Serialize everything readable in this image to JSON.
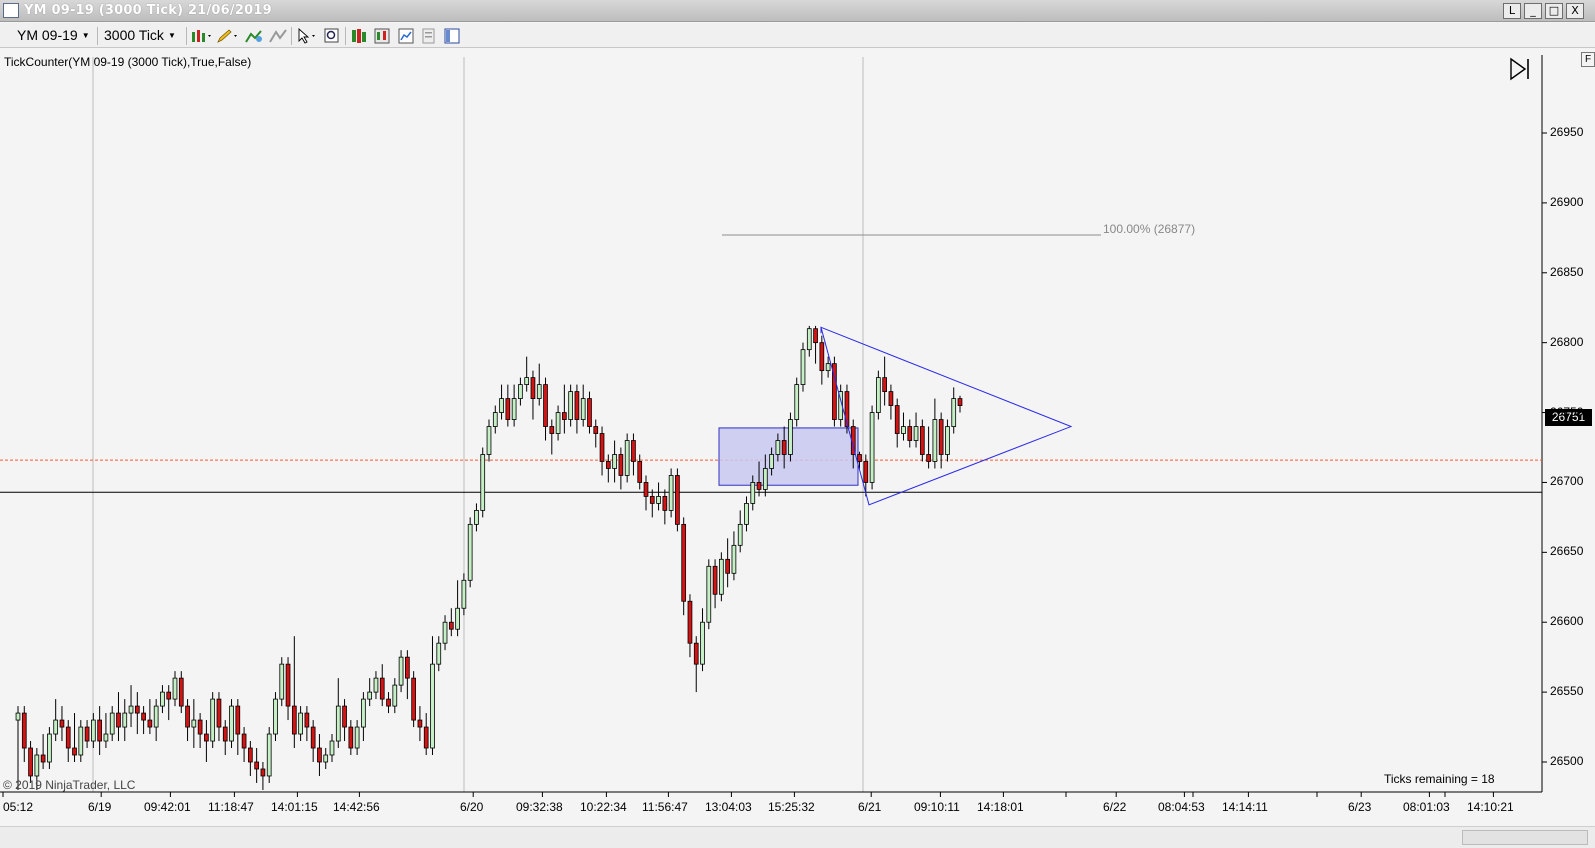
{
  "window": {
    "title": "YM 09-19 (3000 Tick)  21/06/2019",
    "buttons": {
      "restore_small": "L",
      "minimize": "_",
      "maximize": "□",
      "close": "X"
    }
  },
  "toolbar": {
    "instrument": "YM 09-19",
    "interval": "3000 Tick",
    "icons": [
      "bar-type-icon",
      "drawing-pencil-icon",
      "add-indicator-icon",
      "strategy-icon",
      "cursor-icon",
      "zoom-icon",
      "data-box-icon",
      "chart-trader-icon",
      "chart-properties-icon",
      "template-icon",
      "panel-icon"
    ]
  },
  "chart": {
    "indicator_label": "TickCounter(YM 09-19 (3000 Tick),True,False)",
    "ticks_remaining": "Ticks remaining = 18",
    "copyright": "© 2019 NinjaTrader, LLC",
    "fib_label": "100.00% (26877)",
    "current_price": "26751",
    "colors": {
      "up_candle": "#c5f0c5",
      "down_candle": "#d31414",
      "wick": "#000000",
      "triangle": "#2a2ae8",
      "rectangle_fill": "#c8c8f0",
      "rectangle_border": "#3030c0",
      "dashed_line": "#ff5a2a",
      "support_line": "#000000",
      "fib_line": "#8c8c8c"
    }
  },
  "chart_data": {
    "type": "candlestick",
    "price_axis_labels": [
      "26950",
      "26900",
      "26850",
      "26800",
      "26750",
      "26700",
      "26650",
      "26600",
      "26550",
      "26500"
    ],
    "ylim": [
      26492,
      26998
    ],
    "time_axis_labels": [
      "05:12",
      "6/19",
      "09:42:01",
      "11:18:47",
      "14:01:15",
      "14:42:56",
      "6/20",
      "09:32:38",
      "10:22:34",
      "11:56:47",
      "13:04:03",
      "15:25:32",
      "6/21",
      "09:10:11",
      "14:18:01",
      "6/22",
      "08:04:53",
      "14:14:11",
      "6/23",
      "08:01:03",
      "14:10:21"
    ],
    "horizontal_lines": [
      {
        "kind": "dashed",
        "price": 26716
      },
      {
        "kind": "solid",
        "price": 26693
      },
      {
        "kind": "fib-100",
        "price": 26877
      }
    ],
    "rectangle": {
      "price_top": 26739,
      "price_bottom": 26698
    },
    "triangle": {
      "top_price": 26811,
      "bottom_price": 26684,
      "apex_price": 26740
    },
    "candles": [
      [
        26530,
        26535,
        26480,
        26540
      ],
      [
        26535,
        26510,
        26500,
        26540
      ],
      [
        26510,
        26490,
        26485,
        26515
      ],
      [
        26490,
        26505,
        26480,
        26510
      ],
      [
        26505,
        26500,
        26495,
        26520
      ],
      [
        26500,
        26520,
        26495,
        26525
      ],
      [
        26520,
        26530,
        26515,
        26545
      ],
      [
        26530,
        26525,
        26515,
        26540
      ],
      [
        26525,
        26510,
        26500,
        26530
      ],
      [
        26510,
        26505,
        26500,
        26535
      ],
      [
        26505,
        26525,
        26500,
        26530
      ],
      [
        26525,
        26515,
        26510,
        26530
      ],
      [
        26515,
        26530,
        26510,
        26535
      ],
      [
        26530,
        26515,
        26505,
        26540
      ],
      [
        26515,
        26520,
        26510,
        26535
      ],
      [
        26520,
        26535,
        26515,
        26540
      ],
      [
        26535,
        26525,
        26515,
        26550
      ],
      [
        26525,
        26535,
        26515,
        26545
      ],
      [
        26535,
        26540,
        26525,
        26555
      ],
      [
        26540,
        26535,
        26520,
        26550
      ],
      [
        26535,
        26530,
        26520,
        26540
      ],
      [
        26530,
        26525,
        26520,
        26545
      ],
      [
        26525,
        26540,
        26515,
        26545
      ],
      [
        26540,
        26550,
        26535,
        26555
      ],
      [
        26550,
        26545,
        26530,
        26555
      ],
      [
        26545,
        26560,
        26540,
        26565
      ],
      [
        26560,
        26540,
        26535,
        26565
      ],
      [
        26540,
        26525,
        26515,
        26545
      ],
      [
        26525,
        26530,
        26510,
        26545
      ],
      [
        26530,
        26520,
        26510,
        26535
      ],
      [
        26520,
        26515,
        26500,
        26530
      ],
      [
        26515,
        26545,
        26510,
        26550
      ],
      [
        26545,
        26525,
        26515,
        26550
      ],
      [
        26525,
        26515,
        26505,
        26530
      ],
      [
        26515,
        26540,
        26510,
        26545
      ],
      [
        26540,
        26520,
        26505,
        26545
      ],
      [
        26520,
        26510,
        26500,
        26525
      ],
      [
        26510,
        26500,
        26490,
        26515
      ],
      [
        26500,
        26495,
        26485,
        26510
      ],
      [
        26495,
        26490,
        26480,
        26500
      ],
      [
        26490,
        26520,
        26485,
        26525
      ],
      [
        26520,
        26545,
        26515,
        26550
      ],
      [
        26545,
        26570,
        26540,
        26575
      ],
      [
        26570,
        26540,
        26530,
        26575
      ],
      [
        26540,
        26520,
        26510,
        26590
      ],
      [
        26520,
        26535,
        26515,
        26540
      ],
      [
        26535,
        26525,
        26515,
        26540
      ],
      [
        26525,
        26510,
        26500,
        26530
      ],
      [
        26510,
        26500,
        26490,
        26520
      ],
      [
        26500,
        26505,
        26495,
        26510
      ],
      [
        26505,
        26515,
        26500,
        26520
      ],
      [
        26515,
        26540,
        26510,
        26560
      ],
      [
        26540,
        26525,
        26515,
        26545
      ],
      [
        26525,
        26510,
        26505,
        26530
      ],
      [
        26510,
        26525,
        26505,
        26530
      ],
      [
        26525,
        26545,
        26515,
        26550
      ],
      [
        26545,
        26550,
        26540,
        26560
      ],
      [
        26550,
        26560,
        26545,
        26565
      ],
      [
        26560,
        26545,
        26540,
        26570
      ],
      [
        26545,
        26540,
        26535,
        26550
      ],
      [
        26540,
        26555,
        26535,
        26560
      ],
      [
        26555,
        26575,
        26550,
        26580
      ],
      [
        26575,
        26560,
        26545,
        26580
      ],
      [
        26560,
        26530,
        26525,
        26565
      ],
      [
        26530,
        26525,
        26515,
        26540
      ],
      [
        26525,
        26510,
        26505,
        26535
      ],
      [
        26510,
        26570,
        26505,
        26590
      ],
      [
        26570,
        26585,
        26565,
        26590
      ],
      [
        26585,
        26600,
        26580,
        26605
      ],
      [
        26600,
        26595,
        26590,
        26610
      ],
      [
        26595,
        26610,
        26590,
        26630
      ],
      [
        26610,
        26630,
        26605,
        26635
      ],
      [
        26630,
        26670,
        26625,
        26675
      ],
      [
        26670,
        26680,
        26665,
        26685
      ],
      [
        26680,
        26720,
        26675,
        26725
      ],
      [
        26720,
        26740,
        26715,
        26745
      ],
      [
        26740,
        26750,
        26735,
        26755
      ],
      [
        26750,
        26760,
        26745,
        26770
      ],
      [
        26760,
        26745,
        26740,
        26770
      ],
      [
        26745,
        26760,
        26740,
        26770
      ],
      [
        26760,
        26770,
        26755,
        26775
      ],
      [
        26770,
        26775,
        26765,
        26790
      ],
      [
        26775,
        26760,
        26745,
        26780
      ],
      [
        26760,
        26770,
        26755,
        26785
      ],
      [
        26770,
        26740,
        26730,
        26775
      ],
      [
        26740,
        26735,
        26720,
        26745
      ],
      [
        26735,
        26750,
        26730,
        26755
      ],
      [
        26750,
        26745,
        26735,
        26770
      ],
      [
        26745,
        26765,
        26740,
        26770
      ],
      [
        26765,
        26745,
        26735,
        26770
      ],
      [
        26745,
        26760,
        26740,
        26770
      ],
      [
        26760,
        26740,
        26735,
        26765
      ],
      [
        26740,
        26735,
        26725,
        26745
      ],
      [
        26735,
        26715,
        26705,
        26740
      ],
      [
        26715,
        26710,
        26700,
        26720
      ],
      [
        26710,
        26720,
        26700,
        26730
      ],
      [
        26720,
        26705,
        26695,
        26725
      ],
      [
        26705,
        26730,
        26700,
        26735
      ],
      [
        26730,
        26715,
        26705,
        26735
      ],
      [
        26715,
        26700,
        26695,
        26720
      ],
      [
        26700,
        26690,
        26680,
        26705
      ],
      [
        26690,
        26685,
        26675,
        26695
      ],
      [
        26685,
        26690,
        26680,
        26700
      ],
      [
        26690,
        26680,
        26670,
        26695
      ],
      [
        26680,
        26705,
        26675,
        26710
      ],
      [
        26705,
        26670,
        26665,
        26710
      ],
      [
        26670,
        26615,
        26605,
        26675
      ],
      [
        26615,
        26585,
        26575,
        26620
      ],
      [
        26585,
        26570,
        26550,
        26590
      ],
      [
        26570,
        26600,
        26565,
        26610
      ],
      [
        26600,
        26640,
        26595,
        26645
      ],
      [
        26640,
        26620,
        26610,
        26645
      ],
      [
        26620,
        26645,
        26615,
        26650
      ],
      [
        26645,
        26635,
        26625,
        26660
      ],
      [
        26635,
        26655,
        26630,
        26665
      ],
      [
        26655,
        26670,
        26650,
        26680
      ],
      [
        26670,
        26685,
        26665,
        26690
      ],
      [
        26685,
        26700,
        26680,
        26705
      ],
      [
        26700,
        26695,
        26690,
        26715
      ],
      [
        26695,
        26710,
        26690,
        26720
      ],
      [
        26710,
        26720,
        26705,
        26725
      ],
      [
        26720,
        26730,
        26715,
        26735
      ],
      [
        26730,
        26720,
        26710,
        26740
      ],
      [
        26720,
        26745,
        26715,
        26750
      ],
      [
        26745,
        26770,
        26740,
        26775
      ],
      [
        26770,
        26795,
        26765,
        26800
      ],
      [
        26795,
        26810,
        26790,
        26812
      ],
      [
        26810,
        26800,
        26785,
        26812
      ],
      [
        26800,
        26780,
        26770,
        26805
      ],
      [
        26780,
        26785,
        26775,
        26790
      ],
      [
        26785,
        26745,
        26740,
        26790
      ],
      [
        26745,
        26765,
        26740,
        26770
      ],
      [
        26765,
        26740,
        26735,
        26770
      ],
      [
        26740,
        26720,
        26710,
        26745
      ],
      [
        26720,
        26715,
        26710,
        26722
      ],
      [
        26715,
        26700,
        26690,
        26720
      ],
      [
        26700,
        26750,
        26695,
        26755
      ],
      [
        26750,
        26775,
        26745,
        26780
      ],
      [
        26775,
        26765,
        26755,
        26790
      ],
      [
        26765,
        26755,
        26745,
        26770
      ],
      [
        26755,
        26735,
        26725,
        26760
      ],
      [
        26735,
        26740,
        26730,
        26750
      ],
      [
        26740,
        26730,
        26725,
        26745
      ],
      [
        26730,
        26740,
        26725,
        26750
      ],
      [
        26740,
        26720,
        26715,
        26745
      ],
      [
        26720,
        26715,
        26710,
        26740
      ],
      [
        26715,
        26745,
        26710,
        26760
      ],
      [
        26745,
        26720,
        26710,
        26750
      ],
      [
        26720,
        26740,
        26715,
        26745
      ],
      [
        26740,
        26760,
        26735,
        26768
      ],
      [
        26760,
        26755,
        26750,
        26762
      ]
    ]
  }
}
